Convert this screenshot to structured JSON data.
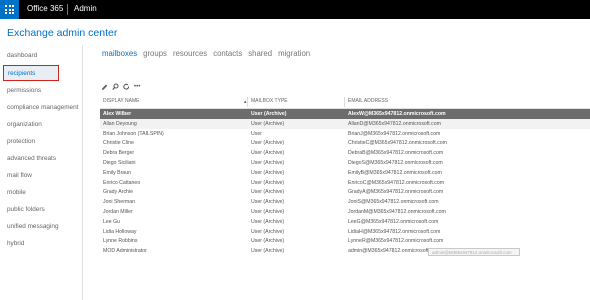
{
  "topbar": {
    "brand": "Office 365",
    "app": "Admin"
  },
  "page_title": "Exchange admin center",
  "sidebar": {
    "items": [
      {
        "label": "dashboard",
        "active": false
      },
      {
        "label": "recipients",
        "active": true
      },
      {
        "label": "permissions",
        "active": false
      },
      {
        "label": "compliance management",
        "active": false
      },
      {
        "label": "organization",
        "active": false
      },
      {
        "label": "protection",
        "active": false
      },
      {
        "label": "advanced threats",
        "active": false
      },
      {
        "label": "mail flow",
        "active": false
      },
      {
        "label": "mobile",
        "active": false
      },
      {
        "label": "public folders",
        "active": false
      },
      {
        "label": "unified messaging",
        "active": false
      },
      {
        "label": "hybrid",
        "active": false
      }
    ]
  },
  "tabs": [
    {
      "label": "mailboxes",
      "active": true
    },
    {
      "label": "groups",
      "active": false
    },
    {
      "label": "resources",
      "active": false
    },
    {
      "label": "contacts",
      "active": false
    },
    {
      "label": "shared",
      "active": false
    },
    {
      "label": "migration",
      "active": false
    }
  ],
  "toolbar": {
    "icons": [
      "pencil-icon",
      "search-icon",
      "refresh-icon",
      "more-icon"
    ],
    "more_label": "•••"
  },
  "table": {
    "columns": [
      "DISPLAY NAME",
      "MAILBOX TYPE",
      "EMAIL ADDRESS"
    ],
    "sort_indicator": "▲",
    "rows": [
      {
        "name": "Alex Wilber",
        "type": "User (Archive)",
        "email": "AlexW@M365x947812.onmicrosoft.com",
        "selected": true
      },
      {
        "name": "Allan Deyoung",
        "type": "User (Archive)",
        "email": "AllanD@M365x947812.onmicrosoft.com",
        "selected": false
      },
      {
        "name": "Brian Johnson (TAILSPIN)",
        "type": "User",
        "email": "BrianJ@M365x947812.onmicrosoft.com",
        "selected": false
      },
      {
        "name": "Christie Cline",
        "type": "User (Archive)",
        "email": "ChristieC@M365x947812.onmicrosoft.com",
        "selected": false
      },
      {
        "name": "Debra Berger",
        "type": "User (Archive)",
        "email": "DebraB@M365x947812.onmicrosoft.com",
        "selected": false
      },
      {
        "name": "Diego Siciliani",
        "type": "User (Archive)",
        "email": "DiegoS@M365x947812.onmicrosoft.com",
        "selected": false
      },
      {
        "name": "Emily Braun",
        "type": "User (Archive)",
        "email": "EmilyB@M365x947812.onmicrosoft.com",
        "selected": false
      },
      {
        "name": "Enrico Cattaneo",
        "type": "User (Archive)",
        "email": "EnricoC@M365x947812.onmicrosoft.com",
        "selected": false
      },
      {
        "name": "Grady Archie",
        "type": "User (Archive)",
        "email": "GradyA@M365x947812.onmicrosoft.com",
        "selected": false
      },
      {
        "name": "Joni Sherman",
        "type": "User (Archive)",
        "email": "JoniS@M365x947812.onmicrosoft.com",
        "selected": false
      },
      {
        "name": "Jordan Miller",
        "type": "User (Archive)",
        "email": "JordanM@M365x947812.onmicrosoft.com",
        "selected": false
      },
      {
        "name": "Lee Gu",
        "type": "User (Archive)",
        "email": "LeeG@M365x947812.onmicrosoft.com",
        "selected": false
      },
      {
        "name": "Lidia Holloway",
        "type": "User (Archive)",
        "email": "LidiaH@M365x947812.onmicrosoft.com",
        "selected": false
      },
      {
        "name": "Lynne Robbins",
        "type": "User (Archive)",
        "email": "LynneR@M365x947812.onmicrosoft.com",
        "selected": false
      },
      {
        "name": "MOD Administrator",
        "type": "User (Archive)",
        "email": "admin@M365x947812.onmicrosoft.com",
        "selected": false
      }
    ]
  },
  "tooltip": "admin@M365x947812.onmicrosoft.com",
  "colors": {
    "accent": "#0072c6",
    "topbar": "#000000",
    "highlight_border": "#d0211c",
    "selected_row": "#6c6c6c"
  }
}
